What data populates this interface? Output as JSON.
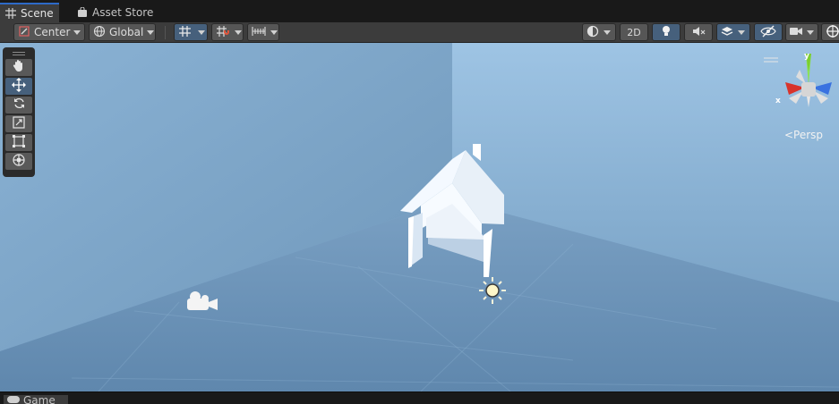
{
  "tabs": {
    "scene": {
      "label": "Scene",
      "icon": "grid-icon"
    },
    "asset_store": {
      "label": "Asset Store",
      "icon": "shopping-bag-icon"
    },
    "game": {
      "label": "Game",
      "icon": "gamepad-icon"
    }
  },
  "toolbar": {
    "pivot_mode": "Center",
    "pivot_rotation": "Global",
    "view_2d": "2D"
  },
  "gizmo": {
    "axis_x": "x",
    "axis_y": "y",
    "projection": "<Persp"
  },
  "colors": {
    "accent": "#2d6ac8",
    "x_axis": "#d8342c",
    "y_axis": "#7ccd31",
    "z_axis": "#3a72e0"
  }
}
